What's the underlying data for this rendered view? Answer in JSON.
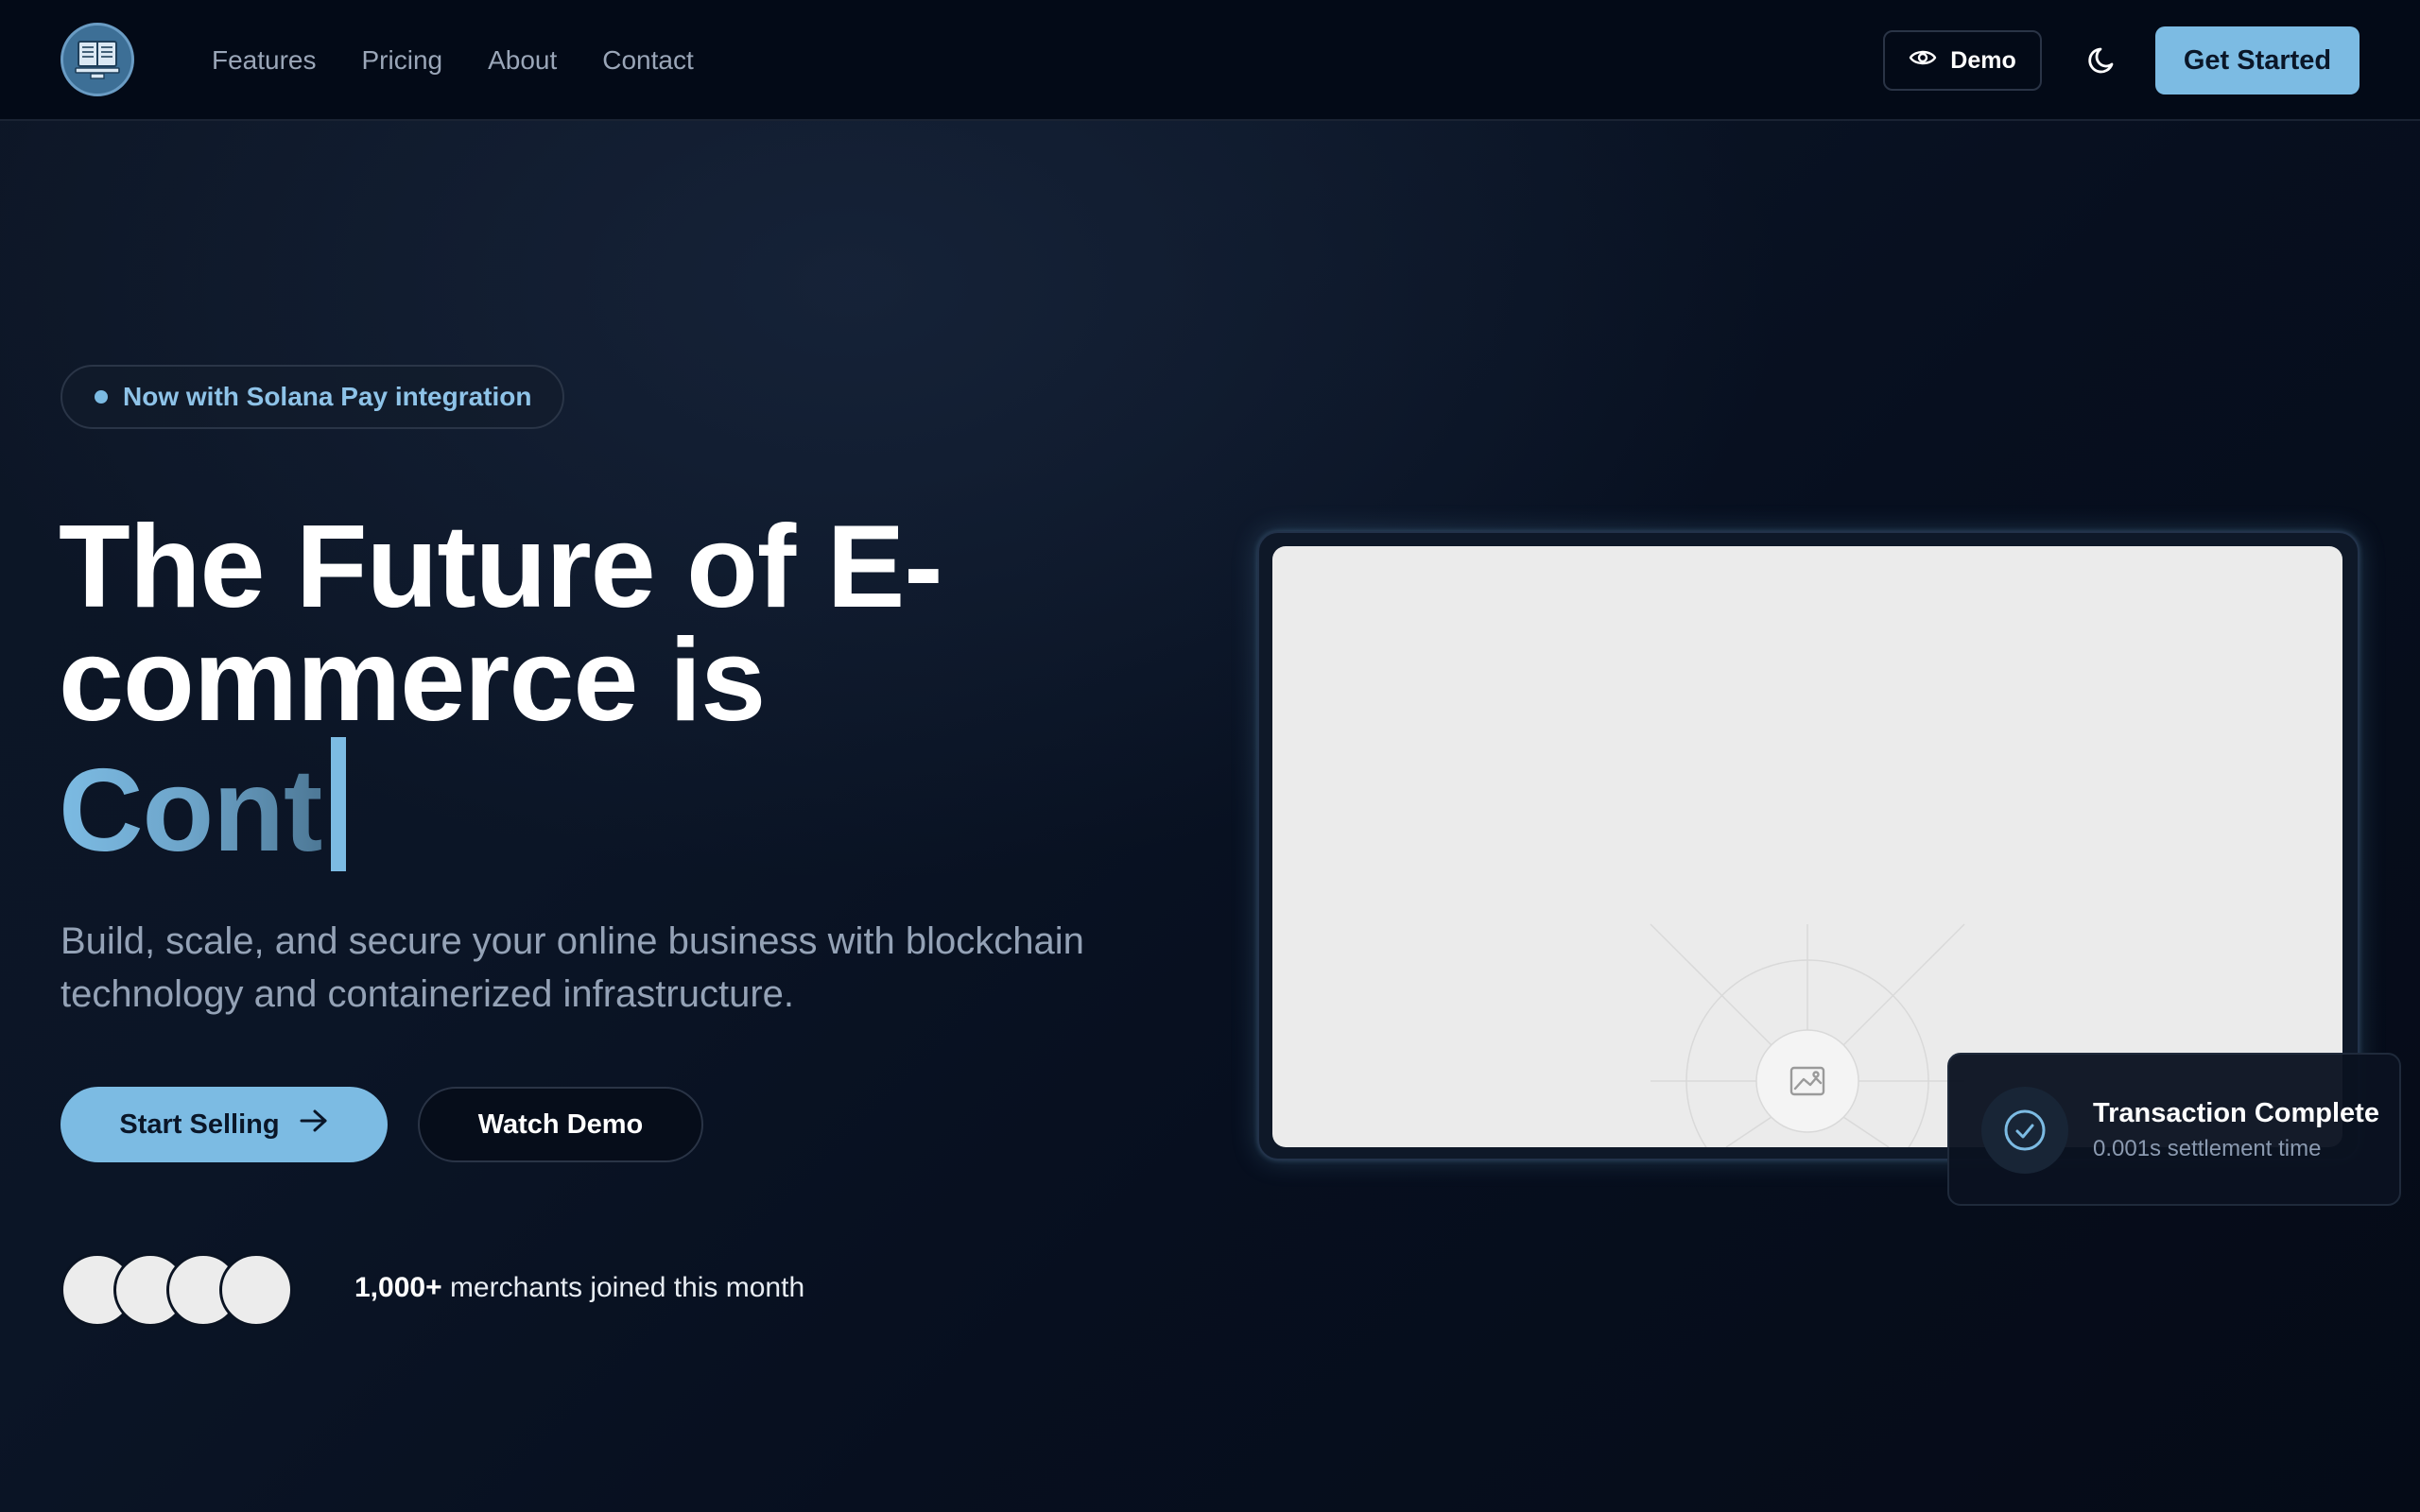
{
  "nav": {
    "logo_icon": "book-laptop-logo-icon",
    "links": [
      {
        "label": "Features"
      },
      {
        "label": "Pricing"
      },
      {
        "label": "About"
      },
      {
        "label": "Contact"
      }
    ],
    "demo_label": "Demo",
    "demo_icon": "eye-icon",
    "theme_icon": "moon-icon",
    "cta_label": "Get Started"
  },
  "hero": {
    "badge": "Now with Solana Pay integration",
    "headline_line1": "The Future of E-",
    "headline_line2": "commerce is",
    "headline_typed": "Cont",
    "subtitle": "Build, scale, and secure your online business with blockchain technology and containerized infrastructure.",
    "primary_cta": "Start Selling",
    "primary_cta_icon": "arrow-right-icon",
    "secondary_cta": "Watch Demo",
    "social_proof_count": "1,000+",
    "social_proof_text": "merchants joined this month"
  },
  "preview": {
    "image_icon": "image-placeholder-icon",
    "toast_title": "Transaction Complete",
    "toast_subtitle": "0.001s settlement time",
    "toast_icon": "check-circle-icon"
  },
  "colors": {
    "accent": "#7cbbe3",
    "background": "#060d1c",
    "nav_background": "#030a17",
    "muted_text": "#94a2b6"
  }
}
